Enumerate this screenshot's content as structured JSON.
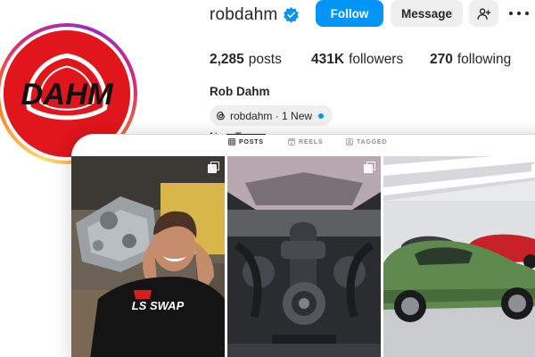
{
  "profile": {
    "username": "robdahm",
    "full_name": "Rob Dahm",
    "verified": true,
    "avatar_logo_text": "DAHM",
    "bio_partial": "Nu... T..."
  },
  "actions": {
    "follow_label": "Follow",
    "message_label": "Message",
    "add_user_icon": "add-person-icon",
    "more_icon": "more-horizontal-icon"
  },
  "stats": {
    "posts_count": "2,285",
    "posts_label": "posts",
    "followers_count": "431K",
    "followers_label": "followers",
    "following_count": "270",
    "following_label": "following"
  },
  "threads": {
    "icon": "threads-icon",
    "label": "robdahm · 1 New"
  },
  "tabs": [
    {
      "label": "POSTS",
      "icon": "grid-icon",
      "active": true
    },
    {
      "label": "REELS",
      "icon": "reels-icon",
      "active": false
    },
    {
      "label": "TAGGED",
      "icon": "tagged-icon",
      "active": false
    }
  ],
  "posts": [
    {
      "shirt_text": "LS SWAP",
      "type": "carousel",
      "description": "man holding engine"
    },
    {
      "type": "carousel",
      "description": "engine bay"
    },
    {
      "type": "carousel",
      "description": "green RX-7 in garage"
    }
  ],
  "colors": {
    "accent": "#0095f6",
    "avatar_bg": "#e0161c",
    "button_gray": "#efefef"
  }
}
